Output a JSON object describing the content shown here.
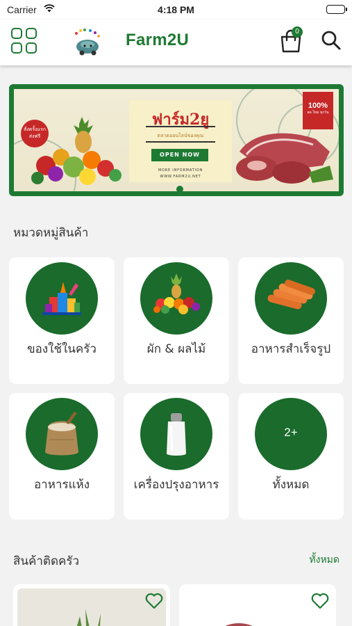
{
  "status_bar": {
    "carrier": "Carrier",
    "time": "4:18 PM"
  },
  "header": {
    "brand": "Farm2U",
    "cart_count": "0"
  },
  "banner": {
    "title": "ฟาร์ม2ยู",
    "subtitle": "ตลาดออนไลน์ของคุณ",
    "button_label": "OPEN NOW",
    "more_info_line1": "MORE INFORMATION",
    "more_info_line2": "WWW.FARM2U.NET",
    "left_badge": "สั่งครั้งแรก ส่งฟรี",
    "right_badge_big": "100%",
    "right_badge_small": "สด ใหม่ ทุกวัน"
  },
  "categories_section": {
    "title": "หมวดหมู่สินค้า",
    "items": [
      {
        "label": "ของใช้ในครัว",
        "icon": "kitchen-supplies-icon"
      },
      {
        "label": "ผัก & ผลไม้",
        "icon": "fruits-vegetables-icon"
      },
      {
        "label": "อาหารสำเร็จรูป",
        "icon": "sausage-icon"
      },
      {
        "label": "อาหารแห้ง",
        "icon": "grain-sack-icon"
      },
      {
        "label": "เครื่องปรุงอาหาร",
        "icon": "salt-shaker-icon"
      },
      {
        "label": "ทั้งหมด",
        "count": "2+"
      }
    ]
  },
  "products_section": {
    "title": "สินค้าติดครัว",
    "see_all": "ทั้งหมด"
  },
  "colors": {
    "brand_green": "#1e7a33",
    "dark_green": "#1a6b2c",
    "badge_red": "#c62828"
  }
}
